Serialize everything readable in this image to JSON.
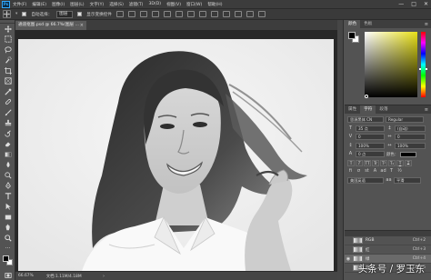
{
  "app": {
    "logo": "Ps"
  },
  "menubar": {
    "items": [
      "文件(F)",
      "编辑(E)",
      "图像(I)",
      "图层(L)",
      "文字(Y)",
      "选择(S)",
      "滤镜(T)",
      "3D(D)",
      "视图(V)",
      "窗口(W)",
      "帮助(H)"
    ],
    "window_controls": {
      "minimize": "—",
      "maximize": "□",
      "close": "✕"
    }
  },
  "options": {
    "auto_select_label": "自动选择：",
    "auto_select_value": "图层",
    "show_transform_label": "显示变换控件"
  },
  "document": {
    "tab_title": "通道抠图.psd @ 66.7%(图层 ...",
    "zoom": "66.67%",
    "doc_info": "文档:1.11M/4.18M"
  },
  "panels": {
    "color": {
      "tab_active": "颜色",
      "tab_other": "色板"
    },
    "character": {
      "tabs": [
        "属性",
        "字符",
        "段落"
      ],
      "font_family": "思源黑体 CN",
      "font_style": "Regular",
      "size": "35 点",
      "leading": "(自动)",
      "kerning": "0",
      "tracking": "0",
      "vscale": "100%",
      "hscale": "100%",
      "baseline": "0 点",
      "color_label": "颜色：",
      "styles": [
        "T",
        "T",
        "TT",
        "Tr",
        "T¹",
        "T₁",
        "T",
        "T"
      ],
      "language": "美国英语",
      "aa_a": "aa",
      "antialias": "平滑"
    },
    "channels": {
      "rows": [
        {
          "name": "RGB",
          "shortcut": "Ctrl+2",
          "visible": false
        },
        {
          "name": "红",
          "shortcut": "Ctrl+3",
          "visible": false
        },
        {
          "name": "绿",
          "shortcut": "Ctrl+4",
          "visible": true
        },
        {
          "name": "蓝",
          "shortcut": "Ctrl+5",
          "visible": false
        }
      ]
    }
  },
  "watermark": "头条号 / 罗玉东"
}
